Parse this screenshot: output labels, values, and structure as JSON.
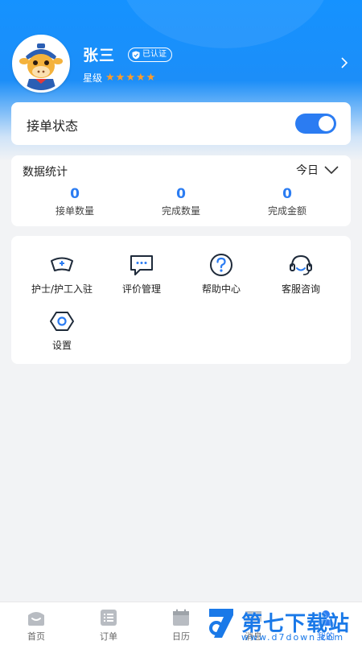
{
  "profile": {
    "name": "张三",
    "verified_label": "已认证",
    "rating_label": "星级",
    "stars": 5
  },
  "status_card": {
    "label": "接单状态",
    "toggle_on": true
  },
  "stats": {
    "title": "数据统计",
    "period": "今日",
    "items": [
      {
        "value": "0",
        "label": "接单数量"
      },
      {
        "value": "0",
        "label": "完成数量"
      },
      {
        "value": "0",
        "label": "完成金额"
      }
    ]
  },
  "menu": {
    "items": [
      {
        "label": "护士/护工入驻",
        "icon": "nurse-cap-icon"
      },
      {
        "label": "评价管理",
        "icon": "comment-icon"
      },
      {
        "label": "帮助中心",
        "icon": "help-icon"
      },
      {
        "label": "客服咨询",
        "icon": "headset-icon"
      },
      {
        "label": "设置",
        "icon": "settings-icon"
      }
    ]
  },
  "tabbar": {
    "items": [
      {
        "label": "首页",
        "icon": "home-icon"
      },
      {
        "label": "订单",
        "icon": "order-icon"
      },
      {
        "label": "日历",
        "icon": "calendar-icon"
      },
      {
        "label": "消息",
        "icon": "message-icon"
      },
      {
        "label": "我的",
        "icon": "profile-icon"
      }
    ],
    "active": 4
  },
  "watermark": {
    "name": "第七下载站",
    "url": "www.d7down.com"
  },
  "colors": {
    "brand": "#2b7cf2",
    "header": "#1592ff",
    "star": "#ff9c2a"
  }
}
